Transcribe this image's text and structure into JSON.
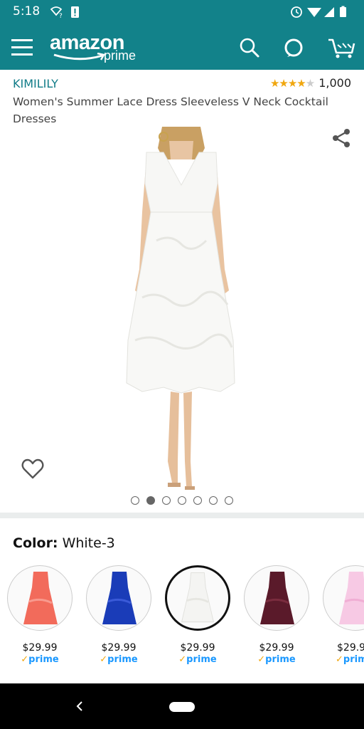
{
  "status_bar": {
    "time": "5:18",
    "icons": [
      "wifi-question-icon",
      "sd-card-alert-icon",
      "alarm-icon",
      "wifi-icon",
      "signal-icon",
      "battery-icon"
    ]
  },
  "app_bar": {
    "logo_text": "amazon",
    "logo_sub": "prime",
    "background": "#12828a"
  },
  "product": {
    "brand": "KIMILILY",
    "rating_stars": "★★★★",
    "rating_empty": "★",
    "rating_value": 4,
    "rating_count": "1,000",
    "title": "Women's Summer Lace Dress Sleeveless V Neck Cocktail Dresses"
  },
  "image_carousel": {
    "total": 7,
    "active_index": 1
  },
  "color": {
    "label": "Color:",
    "selected": "White-3",
    "options": [
      {
        "name": "coral",
        "hex": "#f26b5b",
        "price": "$29.99",
        "prime": "prime",
        "selected": false
      },
      {
        "name": "royal-blue",
        "hex": "#1a3cb8",
        "price": "$29.99",
        "prime": "prime",
        "selected": false
      },
      {
        "name": "white",
        "hex": "#f4f4f2",
        "price": "$29.99",
        "prime": "prime",
        "selected": true
      },
      {
        "name": "burgundy",
        "hex": "#5a1a2a",
        "price": "$29.99",
        "prime": "prime",
        "selected": false
      },
      {
        "name": "pink",
        "hex": "#f7c9e4",
        "price": "$29.9",
        "prime": "prim",
        "selected": false
      }
    ]
  },
  "colors": {
    "teal": "#12828a",
    "brand_link": "#117c88",
    "star": "#f0a70f",
    "prime_blue": "#1a98ff"
  }
}
